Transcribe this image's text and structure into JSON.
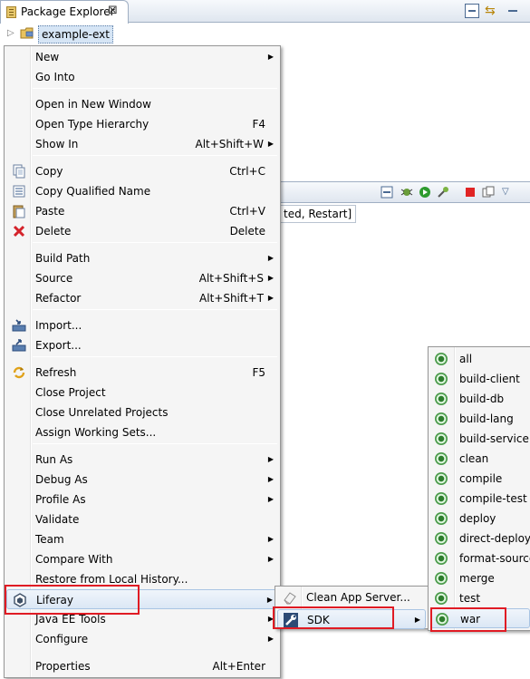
{
  "package_explorer": {
    "tab_label": "Package Explorer",
    "close_glyph": "⊠",
    "project": "example-ext"
  },
  "console": {
    "text": "ted, Restart]"
  },
  "context_menu": {
    "items": [
      {
        "label": "New",
        "accel": "",
        "submenu": true,
        "icon": ""
      },
      {
        "label": "Go Into",
        "accel": "",
        "submenu": false,
        "icon": ""
      },
      {
        "label": "Open in New Window",
        "accel": "",
        "submenu": false,
        "icon": ""
      },
      {
        "label": "Open Type Hierarchy",
        "accel": "F4",
        "submenu": false,
        "icon": ""
      },
      {
        "label": "Show In",
        "accel": "Alt+Shift+W",
        "submenu": true,
        "icon": ""
      },
      {
        "label": "Copy",
        "accel": "Ctrl+C",
        "submenu": false,
        "icon": "copy-icon"
      },
      {
        "label": "Copy Qualified Name",
        "accel": "",
        "submenu": false,
        "icon": "copy-qualified-icon"
      },
      {
        "label": "Paste",
        "accel": "Ctrl+V",
        "submenu": false,
        "icon": "paste-icon"
      },
      {
        "label": "Delete",
        "accel": "Delete",
        "submenu": false,
        "icon": "delete-icon"
      },
      {
        "label": "Build Path",
        "accel": "",
        "submenu": true,
        "icon": ""
      },
      {
        "label": "Source",
        "accel": "Alt+Shift+S",
        "submenu": true,
        "icon": ""
      },
      {
        "label": "Refactor",
        "accel": "Alt+Shift+T",
        "submenu": true,
        "icon": ""
      },
      {
        "label": "Import...",
        "accel": "",
        "submenu": false,
        "icon": "import-icon"
      },
      {
        "label": "Export...",
        "accel": "",
        "submenu": false,
        "icon": "export-icon"
      },
      {
        "label": "Refresh",
        "accel": "F5",
        "submenu": false,
        "icon": "refresh-icon"
      },
      {
        "label": "Close Project",
        "accel": "",
        "submenu": false,
        "icon": ""
      },
      {
        "label": "Close Unrelated Projects",
        "accel": "",
        "submenu": false,
        "icon": ""
      },
      {
        "label": "Assign Working Sets...",
        "accel": "",
        "submenu": false,
        "icon": ""
      },
      {
        "label": "Run As",
        "accel": "",
        "submenu": true,
        "icon": ""
      },
      {
        "label": "Debug As",
        "accel": "",
        "submenu": true,
        "icon": ""
      },
      {
        "label": "Profile As",
        "accel": "",
        "submenu": true,
        "icon": ""
      },
      {
        "label": "Validate",
        "accel": "",
        "submenu": false,
        "icon": ""
      },
      {
        "label": "Team",
        "accel": "",
        "submenu": true,
        "icon": ""
      },
      {
        "label": "Compare With",
        "accel": "",
        "submenu": true,
        "icon": ""
      },
      {
        "label": "Restore from Local History...",
        "accel": "",
        "submenu": false,
        "icon": ""
      },
      {
        "label": "Liferay",
        "accel": "",
        "submenu": true,
        "icon": "liferay-icon",
        "highlighted": true
      },
      {
        "label": "Java EE Tools",
        "accel": "",
        "submenu": true,
        "icon": ""
      },
      {
        "label": "Configure",
        "accel": "",
        "submenu": true,
        "icon": ""
      },
      {
        "label": "Properties",
        "accel": "Alt+Enter",
        "submenu": false,
        "icon": ""
      }
    ]
  },
  "liferay_menu": {
    "items": [
      {
        "label": "Clean App Server...",
        "submenu": false,
        "icon": "eraser-icon"
      },
      {
        "label": "SDK",
        "submenu": true,
        "icon": "sdk-wrench-icon",
        "highlighted": true
      }
    ]
  },
  "sdk_menu": {
    "items": [
      "all",
      "build-client",
      "build-db",
      "build-lang",
      "build-service",
      "clean",
      "compile",
      "compile-test",
      "deploy",
      "direct-deploy",
      "format-source",
      "merge",
      "test",
      "war"
    ],
    "selected": "war"
  },
  "colors": {
    "highlight_outline": "#e01b24",
    "menu_background": "#f5f5f5"
  }
}
